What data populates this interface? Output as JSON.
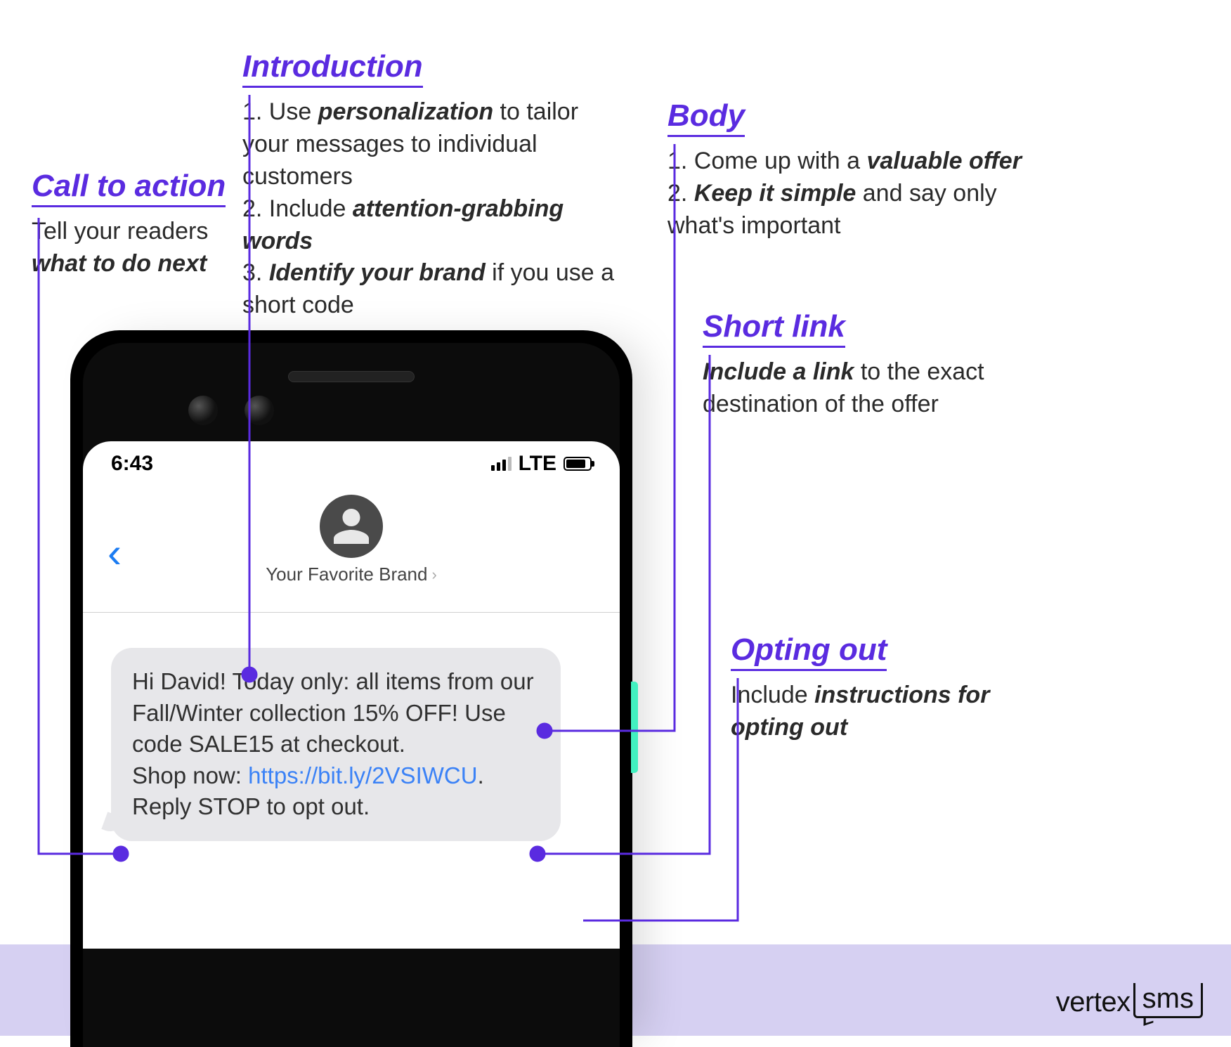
{
  "callouts": {
    "introduction": {
      "title": "Introduction",
      "line1_pre": "1. Use ",
      "line1_bold": "personalization",
      "line1_post": " to tailor your messages to individual customers",
      "line2_pre": "2. Include ",
      "line2_bold": "attention-grabbing words",
      "line3_pre": "3. ",
      "line3_bold": "Identify your brand",
      "line3_post": " if you use a short code"
    },
    "cta": {
      "title": "Call to action",
      "text_pre": "Tell your readers ",
      "text_bold": "what to do next"
    },
    "body": {
      "title": "Body",
      "line1_pre": "1. Come up with a ",
      "line1_bold": "valuable offer",
      "line2_pre": "2. ",
      "line2_bold": "Keep it simple",
      "line2_post": " and say only what's important"
    },
    "shortlink": {
      "title": "Short link",
      "text_bold": "Include a link",
      "text_post": " to the exact destination of the offer"
    },
    "optout": {
      "title": "Opting out",
      "text_pre": "Include ",
      "text_bold": "instructions for opting out"
    }
  },
  "phone": {
    "time": "6:43",
    "carrier": "LTE",
    "sender": "Your Favorite Brand",
    "message": {
      "line1": "Hi David! Today only: all items from our Fall/Winter collection 15% OFF! Use code SALE15 at checkout.",
      "cta_label": "Shop now: ",
      "link": "https://bit.ly/2VSIWCU",
      "link_trail": ".",
      "optout": "Reply STOP to opt out."
    }
  },
  "brand": {
    "left": "vertex",
    "right": "sms"
  }
}
